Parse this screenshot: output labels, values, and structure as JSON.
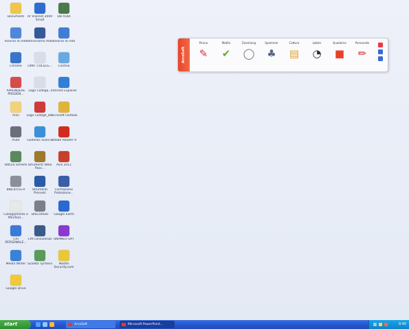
{
  "desktop_icons": [
    {
      "label": "Documenti",
      "icon": "folder-person-icon",
      "color": "#f0c64a"
    },
    {
      "label": "Ar Vilerest 2009 Small",
      "icon": "ar-person-icon",
      "color": "#2f6ccf"
    },
    {
      "label": "DB AUDI",
      "icon": "db-icon",
      "color": "#4a7a4a"
    },
    {
      "label": "Risorse di rete",
      "icon": "network-icon",
      "color": "#4f88d8"
    },
    {
      "label": "Alleveriamo Aldo",
      "icon": "program-icon",
      "color": "#355a9a"
    },
    {
      "label": "Risorse di rete",
      "icon": "network-icon",
      "color": "#3f7ed4"
    },
    {
      "label": "Chrome",
      "icon": "app-icon",
      "color": "#3a74c9"
    },
    {
      "label": "LIMIT COLLEG...",
      "icon": "document-icon",
      "color": "#d8dde8"
    },
    {
      "label": "Cestino",
      "icon": "recycle-bin-icon",
      "color": "#6aa9e0"
    },
    {
      "label": "APPENDERE PREDEM...",
      "icon": "pin-icon",
      "color": "#d84b4b"
    },
    {
      "label": "Logo Collega...",
      "icon": "document-icon",
      "color": "#d9dde8"
    },
    {
      "label": "Internet Explorer",
      "icon": "internet-explorer-icon",
      "color": "#2f7fd8"
    },
    {
      "label": "mini",
      "icon": "folder-icon",
      "color": "#f2d27a"
    },
    {
      "label": "Logo Collegh_D...",
      "icon": "document-icon",
      "color": "#cf3a3a"
    },
    {
      "label": "Microsoft Outlook",
      "icon": "outlook-icon",
      "color": "#e0b33a"
    },
    {
      "label": "AUDI",
      "icon": "audi-icon",
      "color": "#6a6f7a"
    },
    {
      "label": "Godlinks Scarica",
      "icon": "globe-icon",
      "color": "#3b8fd8"
    },
    {
      "label": "Adobe Reader 9",
      "icon": "adobe-reader-icon",
      "color": "#d32a20"
    },
    {
      "label": "lettura Schemi",
      "icon": "picture-icon",
      "color": "#5a8a5a"
    },
    {
      "label": "Strumenti Willa Pass...",
      "icon": "tools-icon",
      "color": "#a0782a"
    },
    {
      "label": "Avis 2011",
      "icon": "avis-icon",
      "color": "#c8402a"
    },
    {
      "label": "BIBLIOTECA",
      "icon": "library-icon",
      "color": "#8a8f9a"
    },
    {
      "label": "Strumenti Prenseli",
      "icon": "tools-icon",
      "color": "#2a5aa8"
    },
    {
      "label": "Formazione Protezione...",
      "icon": "people-icon",
      "color": "#3a5ea8"
    },
    {
      "label": "Collegamento a MiniTool...",
      "icon": "shortcut-icon",
      "color": "#e8e8e8"
    },
    {
      "label": "DISCORDO",
      "icon": "disk-icon",
      "color": "#7a7f8a"
    },
    {
      "label": "Google Earth",
      "icon": "google-earth-icon",
      "color": "#2a6ad0"
    },
    {
      "label": "CRI PERSONALE...",
      "icon": "document-icon",
      "color": "#3a7ad8"
    },
    {
      "label": "CM Consulenza",
      "icon": "cm-icon",
      "color": "#3a5a8a"
    },
    {
      "label": "UNAMEO DPT",
      "icon": "globe-icon",
      "color": "#8a3ad0"
    },
    {
      "label": "Media Writer",
      "icon": "media-icon",
      "color": "#3a82d8"
    },
    {
      "label": "Scadito Tyrrheni",
      "icon": "picture-icon",
      "color": "#5a9a5a"
    },
    {
      "label": "Nestle Security.com",
      "icon": "security-icon",
      "color": "#e8c83a"
    },
    {
      "label": "Google Drive",
      "icon": "drive-icon",
      "color": "#f0c83a"
    }
  ],
  "toolbar": {
    "tab_label": "ArcoSoft",
    "tools": [
      {
        "label": "Penna",
        "glyph": "✎",
        "icon": "pen-icon",
        "color": "#d8303a"
      },
      {
        "label": "Matita",
        "glyph": "✔",
        "icon": "pencil-icon",
        "color": "#6aa83a"
      },
      {
        "label": "Zoomlang",
        "glyph": "◯",
        "icon": "magnifier-icon",
        "color": "#6a6f7a"
      },
      {
        "label": "Spammer",
        "glyph": "♣",
        "icon": "spotlight-icon",
        "color": "#5a6a8a"
      },
      {
        "label": "Cattura",
        "glyph": "▤",
        "icon": "capture-icon",
        "color": "#e0a02a"
      },
      {
        "label": "Lobter",
        "glyph": "◔",
        "icon": "timer-icon",
        "color": "#2a2f3a"
      },
      {
        "label": "Quaderno",
        "glyph": "■",
        "icon": "notebook-icon",
        "color": "#e8402a"
      },
      {
        "label": "Personaliz",
        "glyph": "✏",
        "icon": "marker-icon",
        "color": "#d8302a"
      }
    ],
    "side_buttons": [
      {
        "icon": "close-icon",
        "color": "#e83a4a"
      },
      {
        "icon": "settings-icon",
        "color": "#3a6ad8"
      },
      {
        "icon": "info-icon",
        "color": "#3a6ad8"
      }
    ]
  },
  "taskbar": {
    "start_label": "start",
    "quick_launch": [
      {
        "icon": "internet-explorer-icon",
        "color": "#4fa0ff"
      },
      {
        "icon": "show-desktop-icon",
        "color": "#8fc8ff"
      },
      {
        "icon": "media-player-icon",
        "color": "#ffb83a"
      }
    ],
    "tasks": [
      {
        "label": "ArcoSoft",
        "active": false
      },
      {
        "label": "Microsoft PowerPoint...",
        "active": true
      }
    ],
    "clock": "9.40"
  }
}
